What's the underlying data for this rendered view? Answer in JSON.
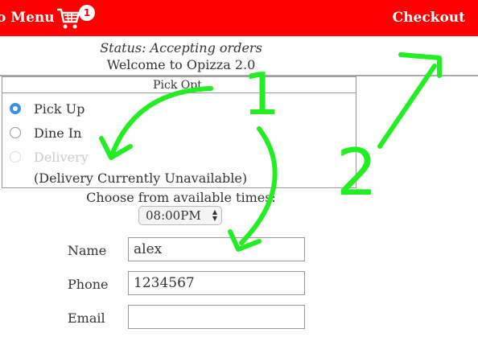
{
  "header": {
    "menu_label": "o Menu",
    "cart_count": "1",
    "checkout_label": "Checkout"
  },
  "status_text": "Status: Accepting orders",
  "welcome_text": "Welcome to Opizza 2.0",
  "pick_options": {
    "legend": "Pick Opt",
    "options": [
      {
        "label": "Pick Up",
        "selected": true,
        "disabled": false
      },
      {
        "label": "Dine In",
        "selected": false,
        "disabled": false
      },
      {
        "label": "Delivery",
        "selected": false,
        "disabled": true
      }
    ],
    "delivery_note": "(Delivery Currently Unavailable)"
  },
  "time": {
    "label": "Choose from available times:",
    "selected": "08:00PM"
  },
  "form": {
    "name_label": "Name",
    "name_value": "alex",
    "phone_label": "Phone",
    "phone_value": "1234567",
    "email_label": "Email",
    "email_value": ""
  },
  "annotations": {
    "step1": "1",
    "step2": "2",
    "color": "#22ee22"
  },
  "colors": {
    "header_bg": "#ff0000",
    "radio_selected": "#3b8ee6"
  }
}
